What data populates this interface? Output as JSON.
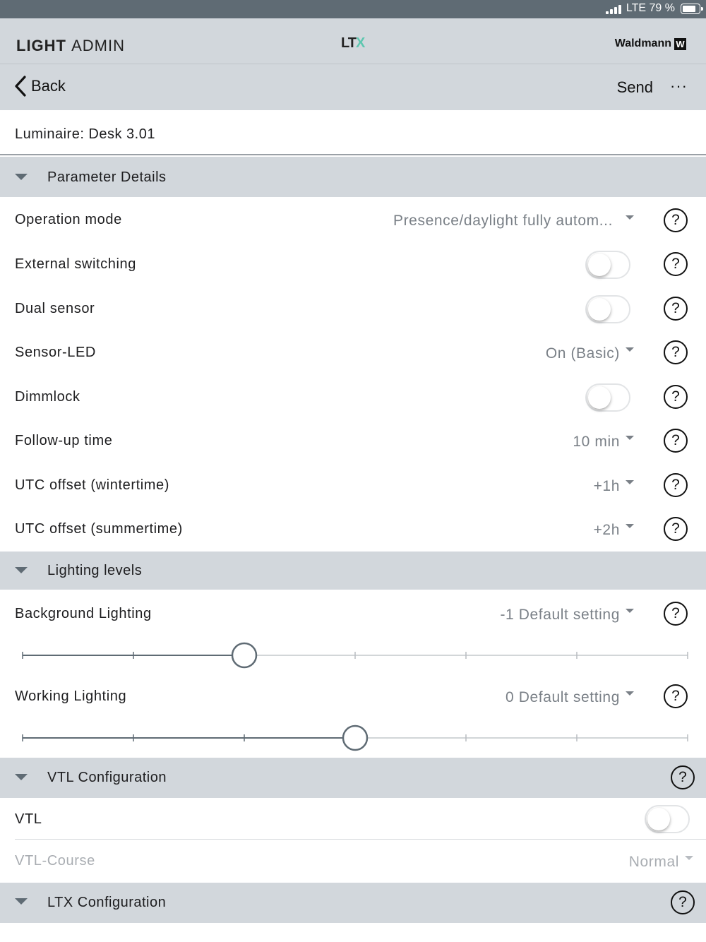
{
  "status_bar": {
    "network": "LTE",
    "battery": "79 %"
  },
  "app_header": {
    "title_bold": "LIGHT",
    "title_rest": "ADMIN",
    "logo": "LT",
    "logo_accent": "X",
    "brand": "Waldmann",
    "brand_mark": "W"
  },
  "nav": {
    "back_label": "Back",
    "send_label": "Send",
    "more_label": "···"
  },
  "luminaire": "Luminaire: Desk 3.01",
  "sections": {
    "parameter_details": "Parameter Details",
    "lighting_levels": "Lighting levels",
    "vtl_configuration": "VTL Configuration",
    "ltx_configuration": "LTX Configuration"
  },
  "parameters": {
    "operation_mode": {
      "label": "Operation mode",
      "value": "Presence/daylight fully autom..."
    },
    "external_switching": {
      "label": "External switching",
      "on": false
    },
    "dual_sensor": {
      "label": "Dual sensor",
      "on": false
    },
    "sensor_led": {
      "label": "Sensor-LED",
      "value": "On (Basic)"
    },
    "dimmlock": {
      "label": "Dimmlock",
      "on": false
    },
    "follow_up_time": {
      "label": "Follow-up time",
      "value": "10 min"
    },
    "utc_winter": {
      "label": "UTC offset (wintertime)",
      "value": "+1h"
    },
    "utc_summer": {
      "label": "UTC offset (summertime)",
      "value": "+2h"
    }
  },
  "lighting": {
    "background": {
      "label": "Background Lighting",
      "value": "-1 Default setting",
      "level": -1,
      "min": -3,
      "max": 3
    },
    "working": {
      "label": "Working Lighting",
      "value": "0 Default setting",
      "level": 0,
      "min": -3,
      "max": 3
    }
  },
  "vtl": {
    "vtl": {
      "label": "VTL",
      "on": false
    },
    "vtl_course": {
      "label": "VTL-Course",
      "value": "Normal"
    }
  },
  "help_symbol": "?",
  "colors": {
    "header_bg": "#d2d7dc",
    "status_bg": "#5f6b74",
    "accent": "#5ec7b0",
    "slider_track": "#5f6b74"
  }
}
